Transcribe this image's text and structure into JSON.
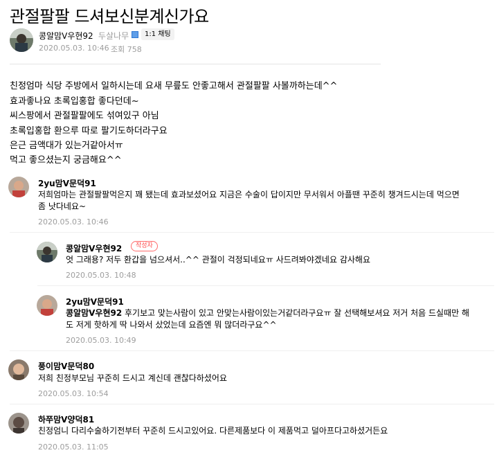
{
  "post": {
    "title": "관절팔팔 드셔보신분계신가요",
    "author": "콩알맘V우현92",
    "grade": "두살나무",
    "chat_button": "1:1 채팅",
    "date": "2020.05.03. 10:46",
    "views": "조회 758",
    "body": [
      "친정엄마 식당 주방에서 일하시는데 요새 무릎도 안좋고해서 관절팔팔 사볼까하는데^^",
      "효과좋나요 초록입홍합 좋다던데~",
      "씨스팡에서 관절팔팔에도 섞여있구 아님",
      "초록입홍합 환으루 따로 팔기도하더라구요",
      "은근 금액대가 있는거같아서ㅠ",
      "먹고 좋으셨는지 궁금해요^^"
    ]
  },
  "comments": [
    {
      "author": "2yu맘V문덕91",
      "lines": [
        "저희엄마는 관절팔팔먹은지 꽤 됐는데 효과보셨어요 지금은 수술이 답이지만 무서워서 아플땐 꾸준히 챙겨드시는데 먹으면",
        "좀 낫다네요~"
      ],
      "date": "2020.05.03. 10:46"
    },
    {
      "author": "콩알맘V우현92",
      "badge": "작성자",
      "lines": [
        "엇 그래용? 저두 환갑을 넘으셔서..^^ 관절이 걱정되네요ㅠ 사드려봐야겠네요 감사해요"
      ],
      "date": "2020.05.03. 10:48"
    },
    {
      "author": "2yu맘V문덕91",
      "mention": "콩알맘V우현92",
      "lines": [
        " 후기보고 맞는사람이 있고 안맞는사람이있는거같더라구요ㅠ 잘 선택해보셔요 저거 처음 드실때만 해",
        "도 저게 핫하게 딱 나와서 샀었는데 요즘엔 뭐 많더라구요^^"
      ],
      "date": "2020.05.03. 10:49"
    },
    {
      "author": "풍이맘V문덕80",
      "lines": [
        "저희 친정부모님 꾸준히 드시고 계신데 괜찮다하셨어요"
      ],
      "date": "2020.05.03. 10:54"
    },
    {
      "author": "하쭈맘V양덕81",
      "lines": [
        "친정엄니 다리수술하기전부터 꾸준히 드시고있어요. 다른제품보다 이 제품먹고 덜아프다고하셨거든요"
      ],
      "date": "2020.05.03. 11:05"
    }
  ],
  "colors": {
    "meta_gray": "#9d9d9d",
    "badge_red": "#ff4b4b",
    "grade_badge_blue": "#5f9ee8"
  }
}
